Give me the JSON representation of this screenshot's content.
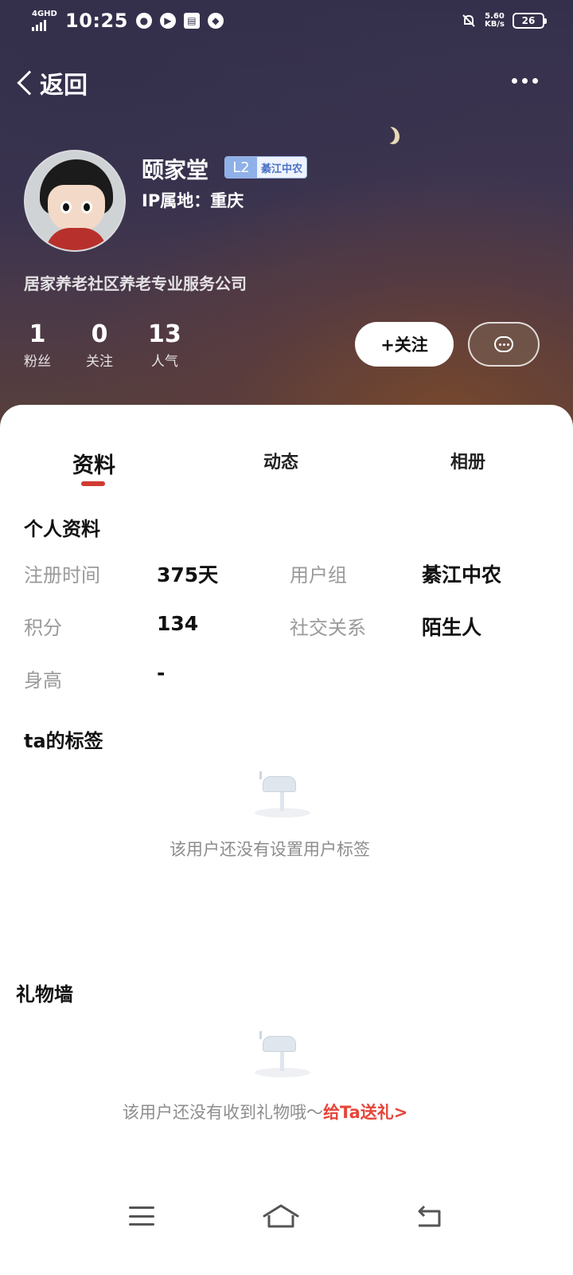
{
  "status_bar": {
    "network": "4GHD",
    "time": "10:25",
    "speed_value": "5.60",
    "speed_unit": "KB/s",
    "battery": "26"
  },
  "header": {
    "back_label": "返回"
  },
  "profile": {
    "name": "颐家堂",
    "level": "L2",
    "group_badge": "綦江中农",
    "ip_location": "IP属地：重庆",
    "bio": "居家养老社区养老专业服务公司",
    "stats": [
      {
        "value": "1",
        "label": "粉丝"
      },
      {
        "value": "0",
        "label": "关注"
      },
      {
        "value": "13",
        "label": "人气"
      }
    ],
    "follow_label": "+关注"
  },
  "tabs": [
    {
      "label": "资料",
      "active": true
    },
    {
      "label": "动态",
      "active": false
    },
    {
      "label": "相册",
      "active": false
    }
  ],
  "personal_info": {
    "title": "个人资料",
    "fields": [
      {
        "key": "注册时间",
        "value": "375天"
      },
      {
        "key": "用户组",
        "value": "綦江中农"
      },
      {
        "key": "积分",
        "value": "134"
      },
      {
        "key": "社交关系",
        "value": "陌生人"
      },
      {
        "key": "身高",
        "value": "-"
      }
    ]
  },
  "tags_section": {
    "title": "ta的标签",
    "empty_text": "该用户还没有设置用户标签"
  },
  "gift_section": {
    "title": "礼物墙",
    "empty_text": "该用户还没有收到礼物哦～",
    "gift_link": "给Ta送礼>"
  },
  "colors": {
    "accent": "#cf3b31",
    "link": "#e5453a",
    "badge_blue": "#8fb0e8"
  },
  "icons": [
    "back-chevron-icon",
    "more-icon",
    "message-icon",
    "mailbox-icon",
    "menu-icon",
    "home-icon",
    "return-icon"
  ]
}
